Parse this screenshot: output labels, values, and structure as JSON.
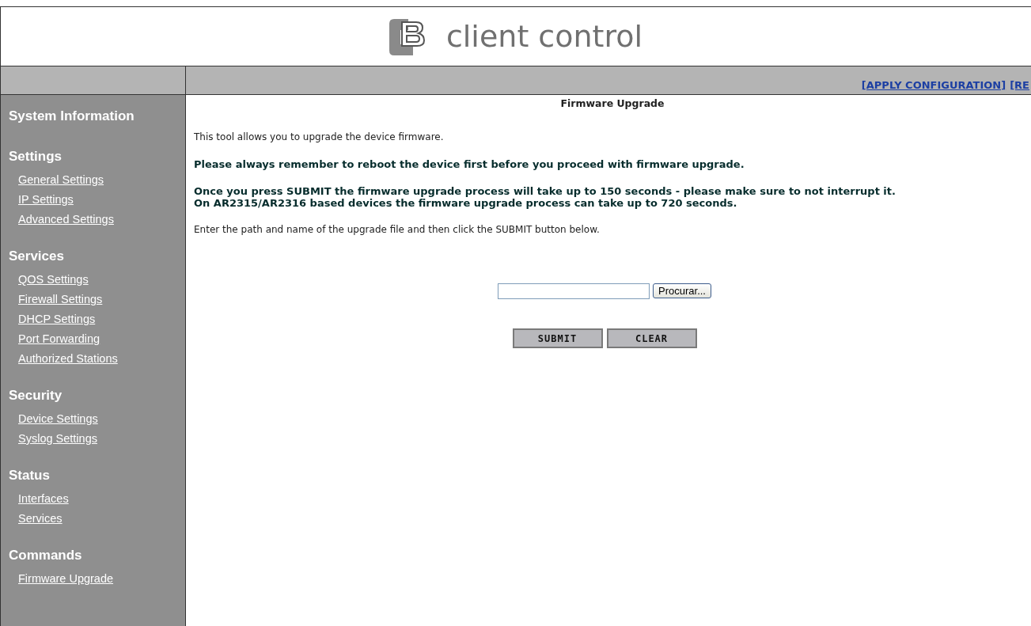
{
  "header": {
    "title": "client control"
  },
  "toolbar": {
    "links": [
      "[APPLY CONFIGURATION]",
      "[RE"
    ]
  },
  "sidebar": {
    "sections": [
      {
        "title": "System Information"
      },
      {
        "title": "Settings",
        "items": [
          "General Settings",
          "IP Settings",
          "Advanced Settings"
        ]
      },
      {
        "title": "Services",
        "items": [
          "QOS Settings",
          "Firewall Settings",
          "DHCP Settings",
          "Port Forwarding",
          "Authorized Stations"
        ]
      },
      {
        "title": "Security",
        "items": [
          "Device Settings",
          "Syslog Settings"
        ]
      },
      {
        "title": "Status",
        "items": [
          "Interfaces",
          "Services"
        ]
      },
      {
        "title": "Commands",
        "items": [
          "Firmware Upgrade"
        ]
      }
    ]
  },
  "content": {
    "title": "Firmware Upgrade",
    "paragraphs": [
      {
        "kind": "plain",
        "text": "This tool allows you to upgrade the device firmware."
      },
      {
        "kind": "bold",
        "text": "Please always remember to reboot the device first before you proceed with firmware upgrade."
      },
      {
        "kind": "bold",
        "text": "Once you press SUBMIT the firmware upgrade process will take up to 150 seconds - please make sure to not interrupt it.\nOn AR2315/AR2316 based devices the firmware upgrade process can take up to 720 seconds."
      },
      {
        "kind": "plain",
        "text": "Enter the path and name of the upgrade file and then click the SUBMIT button below."
      }
    ],
    "browse_button": "Procurar...",
    "buttons": [
      "SUBMIT",
      "CLEAR"
    ]
  }
}
